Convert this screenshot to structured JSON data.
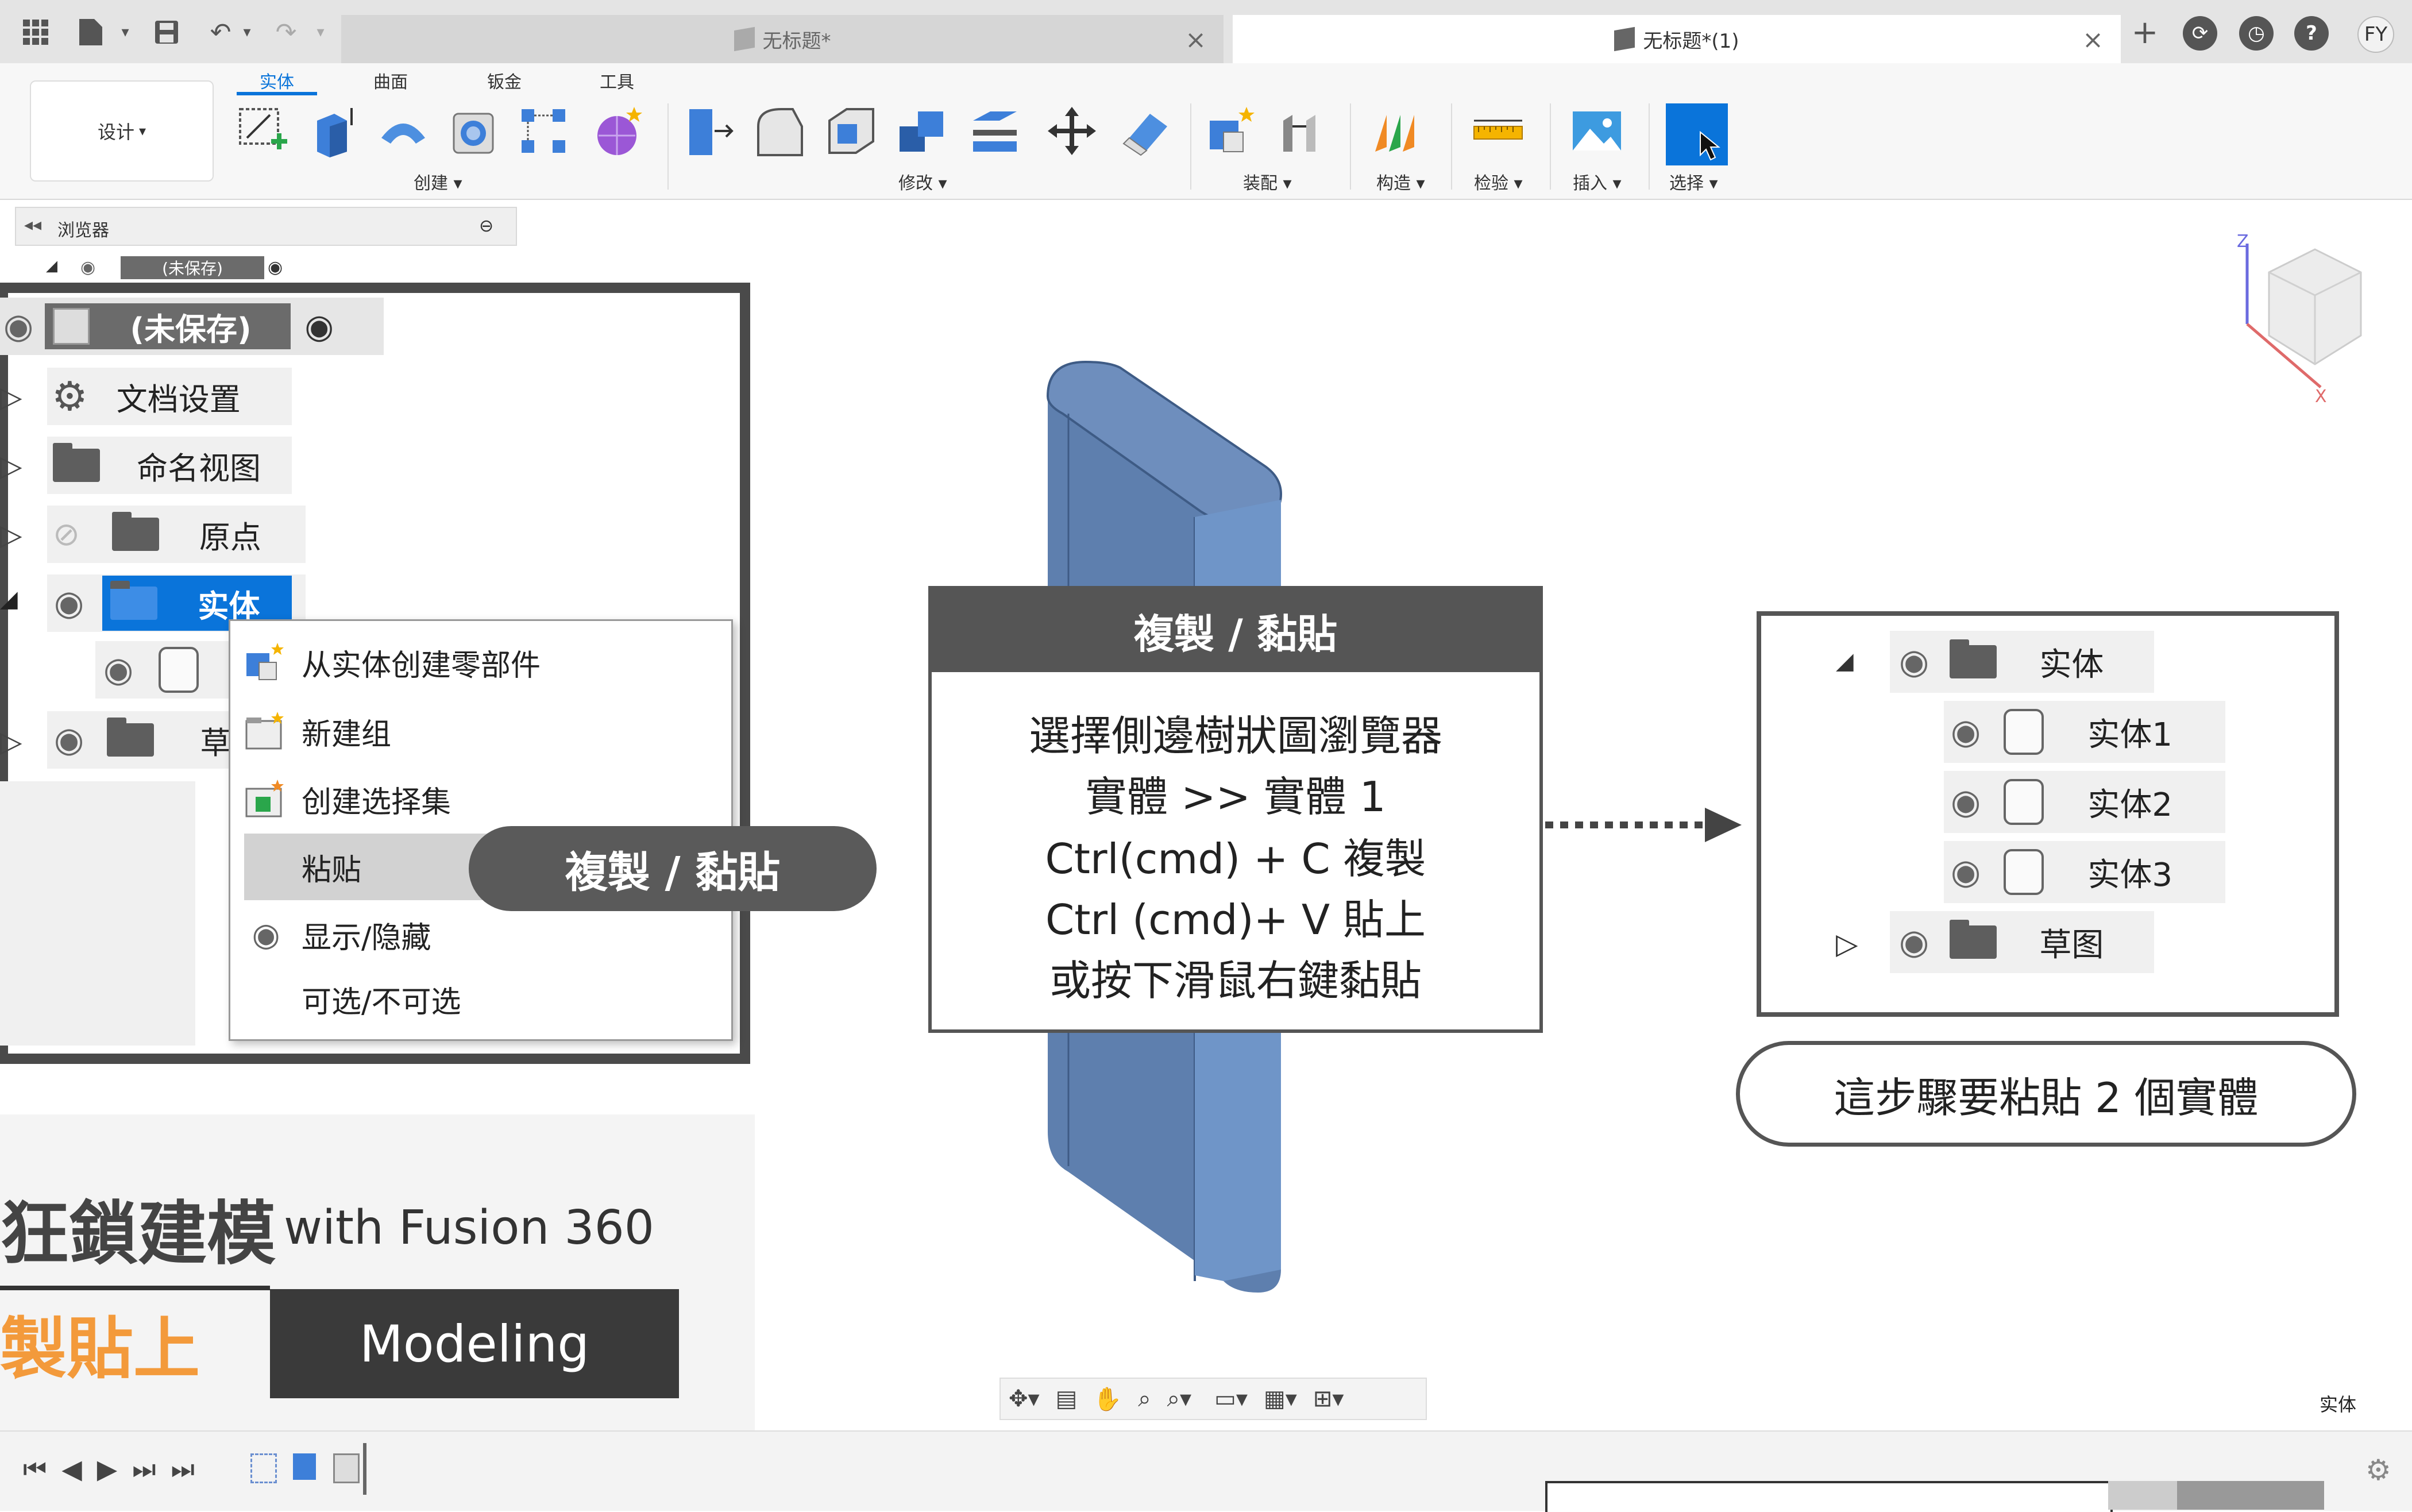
{
  "titlebar": {
    "tabs": [
      {
        "label": "无标题*",
        "active": false
      },
      {
        "label": "无标题*(1)",
        "active": true
      }
    ],
    "avatar": "FY"
  },
  "ribbon": {
    "workspace_button": "设计",
    "tabs": [
      "实体",
      "曲面",
      "钣金",
      "工具"
    ],
    "active_tab": "实体",
    "groups": [
      "创建",
      "修改",
      "装配",
      "构造",
      "检验",
      "插入",
      "选择"
    ]
  },
  "browser": {
    "title": "浏览器",
    "root_label": "(未保存)"
  },
  "tree": {
    "root": "(未保存)",
    "items": [
      "文档设置",
      "命名视图",
      "原点",
      "实体",
      "草"
    ]
  },
  "context_menu": {
    "items": [
      "从实体创建零部件",
      "新建组",
      "创建选择集",
      "粘贴",
      "显示/隐藏",
      "可选/不可选"
    ],
    "highlighted": "粘贴"
  },
  "callouts": {
    "pill": "複製 / 黏貼",
    "main_title": "複製 / 黏貼",
    "main_lines": [
      "選擇側邊樹狀圖瀏覽器",
      "實體 >> 實體 1",
      "Ctrl(cmd) + C  複製",
      "Ctrl (cmd)+ V  貼上",
      "或按下滑鼠右鍵黏貼"
    ],
    "note": "這步驟要粘貼 2 個實體"
  },
  "result_tree": {
    "folder": "实体",
    "bodies": [
      "实体1",
      "实体2",
      "实体3"
    ],
    "sketch": "草图"
  },
  "brand": {
    "title_cn": "狂鎖建模",
    "title_en": "with Fusion 360",
    "subtitle": "製貼上",
    "badge": "Modeling"
  },
  "status": {
    "selection_label": "实体"
  },
  "colors": {
    "accent_blue": "#0a74da",
    "body_blue": "#6a8fbd",
    "callout_dark": "#555555",
    "brand_orange": "#f39a3b"
  }
}
